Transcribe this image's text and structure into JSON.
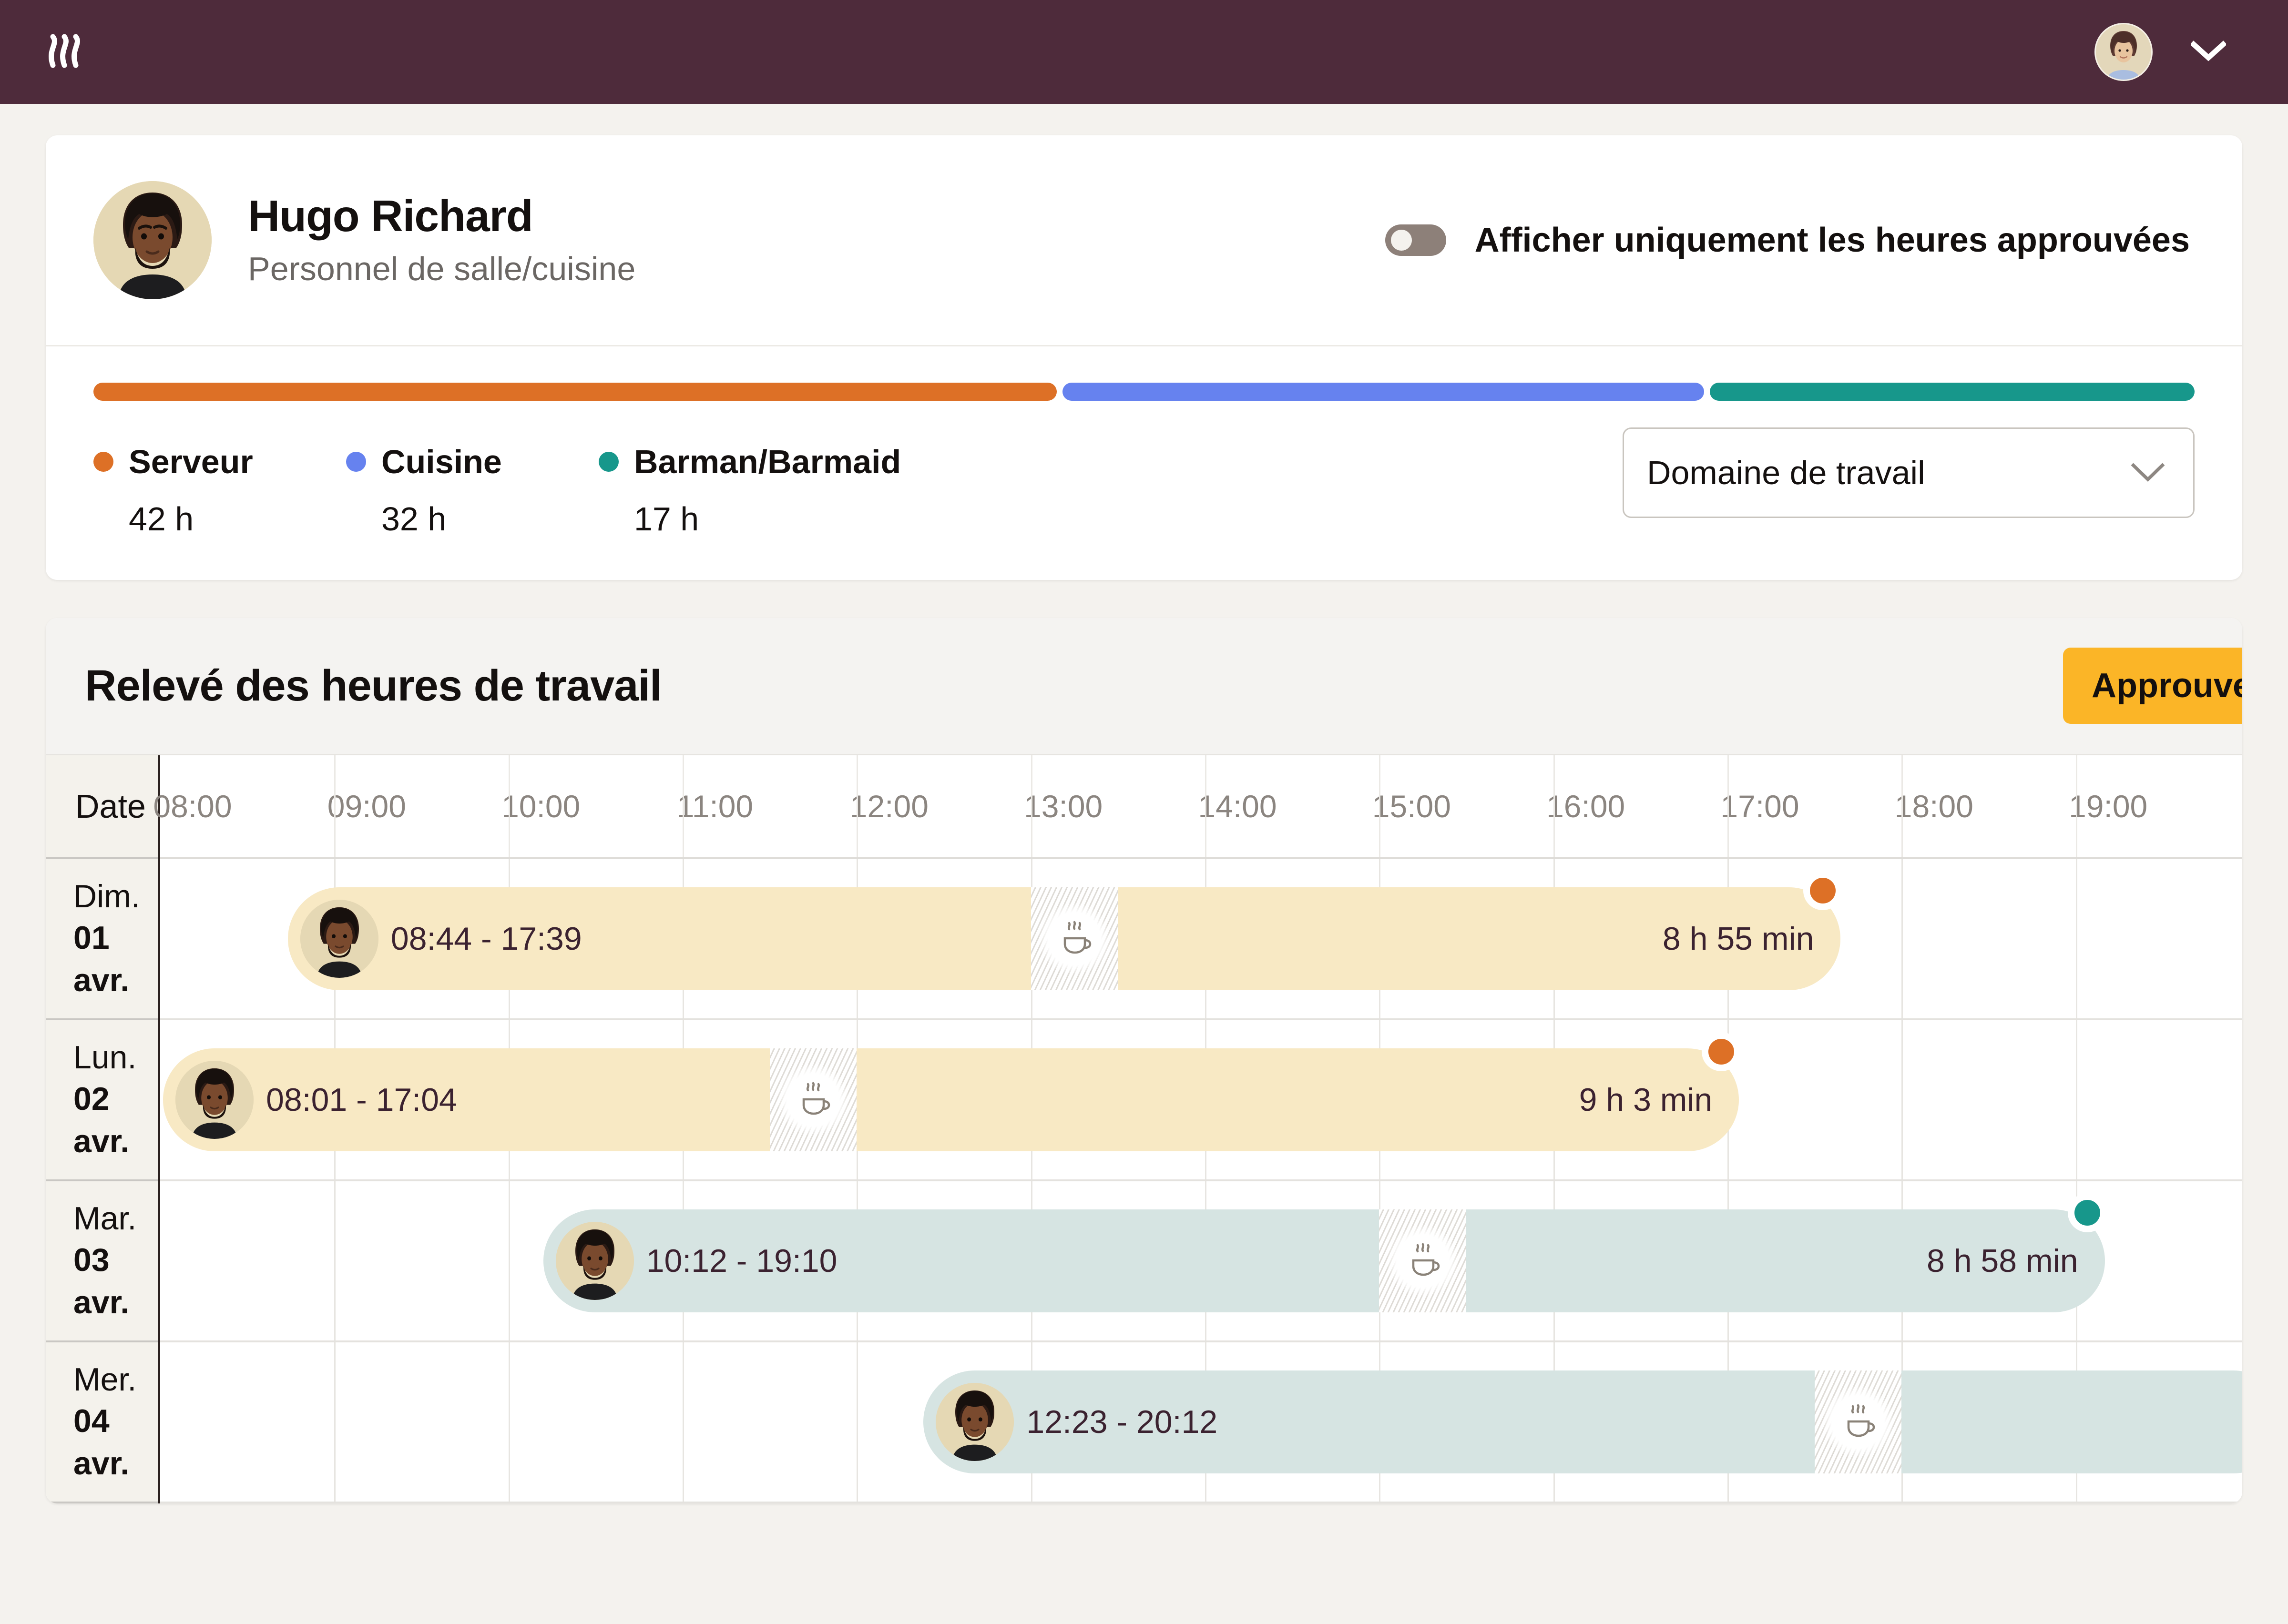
{
  "topbar": {
    "logo_icon": "wave-logo-icon",
    "bg": "#4e2b3b",
    "user_avatar_icon": "user-avatar",
    "chevron_icon": "chevron-down-icon"
  },
  "profile": {
    "avatar_icon": "employee-avatar",
    "name": "Hugo Richard",
    "role": "Personnel de salle/cuisine",
    "toggle": {
      "label": "Afficher uniquement les heures approuvées",
      "checked": false
    }
  },
  "stats": {
    "segments": [
      {
        "label": "Serveur",
        "hours": "42 h",
        "color": "#dd7026",
        "pct": 46.1
      },
      {
        "label": "Cuisine",
        "hours": "32 h",
        "color": "#6682ef",
        "pct": 30.7
      },
      {
        "label": "Barman/Barmaid",
        "hours": "17 h",
        "color": "#17978b",
        "pct": 23.2
      }
    ],
    "filter": {
      "value": "Domaine de travail",
      "chevron_icon": "chevron-down-icon"
    }
  },
  "timesheet": {
    "title": "Relevé des heures de travail",
    "approve_all_label": "Approuver tout",
    "approve_all_color": "#fbb527",
    "date_column_header": "Date",
    "time_labels": [
      "08:00",
      "09:00",
      "10:00",
      "11:00",
      "12:00",
      "13:00",
      "14:00",
      "15:00",
      "16:00",
      "17:00",
      "18:00",
      "19:00"
    ],
    "axis_start": "08:00",
    "axis_end": "20:00",
    "rows": [
      {
        "weekday": "Dim.",
        "day": "01 avr.",
        "range": "08:44 - 17:39",
        "duration": "8 h 55 min",
        "start": "08:44",
        "end": "17:39",
        "break_start": "13:00",
        "break_end": "13:30",
        "break_icon": "coffee-cup-icon",
        "bar_color": "#f8e9c4",
        "endpoint_color": "#dd7026",
        "job": "Serveur"
      },
      {
        "weekday": "Lun.",
        "day": "02 avr.",
        "range": "08:01 - 17:04",
        "duration": "9 h 3 min",
        "start": "08:01",
        "end": "17:04",
        "break_start": "11:30",
        "break_end": "12:00",
        "break_icon": "coffee-cup-icon",
        "bar_color": "#f8e9c4",
        "endpoint_color": "#dd7026",
        "job": "Serveur"
      },
      {
        "weekday": "Mar.",
        "day": "03 avr.",
        "range": "10:12 - 19:10",
        "duration": "8 h 58 min",
        "start": "10:12",
        "end": "19:10",
        "break_start": "15:00",
        "break_end": "15:30",
        "break_icon": "coffee-cup-icon",
        "bar_color": "#d6e4e2",
        "endpoint_color": "#17978b",
        "job": "Barman/Barmaid"
      },
      {
        "weekday": "Mer.",
        "day": "04 avr.",
        "range": "12:23 - 20:12",
        "duration": "",
        "start": "12:23",
        "end": "20:12",
        "break_start": "17:30",
        "break_end": "18:00",
        "break_icon": "coffee-cup-icon",
        "bar_color": "#d6e4e2",
        "endpoint_color": "#17978b",
        "job": "Barman/Barmaid"
      }
    ]
  }
}
